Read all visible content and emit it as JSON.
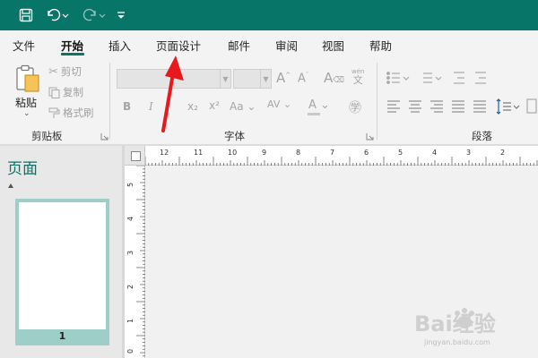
{
  "qat": {
    "save_icon": "save-icon",
    "undo_icon": "undo-icon",
    "redo_icon": "redo-icon",
    "customize_icon": "customize-qat-icon"
  },
  "tabs": [
    {
      "label": "文件"
    },
    {
      "label": "开始",
      "active": true
    },
    {
      "label": "插入"
    },
    {
      "label": "页面设计"
    },
    {
      "label": "邮件"
    },
    {
      "label": "审阅"
    },
    {
      "label": "视图"
    },
    {
      "label": "帮助"
    }
  ],
  "clipboard": {
    "paste_label": "粘贴",
    "cut_label": "剪切",
    "copy_label": "复制",
    "format_painter_label": "格式刷",
    "group_label": "剪贴板"
  },
  "font": {
    "font_name": "",
    "font_size": "",
    "bold": "B",
    "italic": "I",
    "subscript": "x₂",
    "superscript": "x²",
    "change_case": "Aa",
    "char_spacing": "AV",
    "font_color": "A",
    "group_label": "字体"
  },
  "paragraph": {
    "group_label": "段落"
  },
  "pages_pane": {
    "title": "页面",
    "page_number": "1"
  },
  "ruler": {
    "horizontal_labels": [
      "12",
      "11",
      "10",
      "9",
      "8",
      "7",
      "6",
      "5",
      "4",
      "3",
      "2"
    ],
    "vertical_labels": [
      "5",
      "4",
      "3",
      "2",
      "1",
      "0"
    ]
  },
  "watermark": {
    "brand": "Bai经验",
    "url": "jingyan.baidu.com"
  },
  "colors": {
    "accent": "#077568",
    "annotation_arrow": "#e8191c"
  }
}
